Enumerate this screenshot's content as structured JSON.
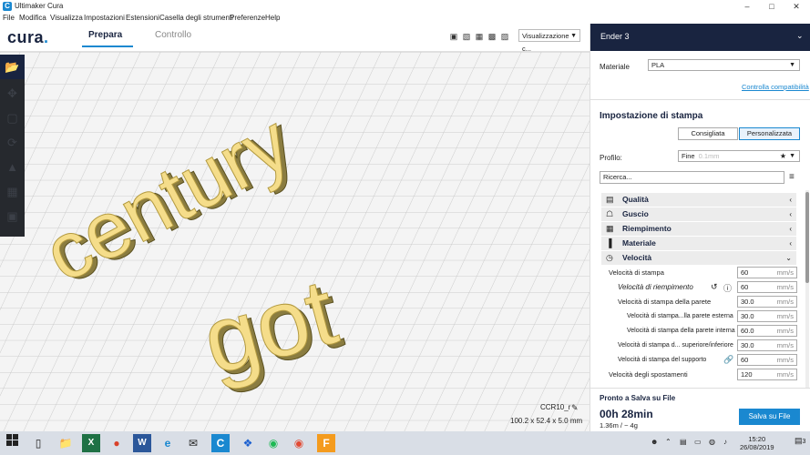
{
  "window": {
    "title": "Ultimaker Cura",
    "minimize": "–",
    "maximize": "□",
    "close": "✕"
  },
  "menu": [
    "File",
    "Modifica",
    "Visualizza",
    "Impostazioni",
    "Estensioni",
    "Casella degli strumenti",
    "Preferenze",
    "Help"
  ],
  "header": {
    "logo": "cura",
    "tabs": {
      "prepare": "Prepara",
      "monitor": "Controllo"
    },
    "view_select": "Visualizzazione c...",
    "view_icons": [
      "cube-3d-icon",
      "cube-front-icon",
      "cube-top-icon",
      "cube-left-icon",
      "cube-right-icon"
    ]
  },
  "scene": {
    "text_top": "century",
    "text_bottom": "got",
    "color": "#f5dd8a",
    "object_name": "CCR10_r",
    "object_dims": "100.2 x 52.4 x 5.0 mm"
  },
  "panel": {
    "printer": "Ender 3",
    "material_label": "Materiale",
    "material_value": "PLA",
    "compat_link": "Controlla compatibilità",
    "settings_title": "Impostazione di stampa",
    "mode_recommended": "Consigliata",
    "mode_custom": "Personalizzata",
    "profile_label": "Profilo:",
    "profile_value": "Fine",
    "profile_sub": "0.1mm",
    "search_placeholder": "Ricerca...",
    "categories": [
      {
        "label": "Qualità",
        "icon": "quality-icon",
        "glyph": "▤"
      },
      {
        "label": "Guscio",
        "icon": "shell-icon",
        "glyph": "☖"
      },
      {
        "label": "Riempimento",
        "icon": "infill-icon",
        "glyph": "▦"
      },
      {
        "label": "Materiale",
        "icon": "material-icon",
        "glyph": "▐"
      },
      {
        "label": "Velocità",
        "icon": "speed-icon",
        "glyph": "◷"
      }
    ],
    "speed_rows": [
      {
        "label": "Velocità di stampa",
        "value": "60",
        "unit": "mm/s"
      },
      {
        "label": "Velocità di riempimento",
        "value": "60",
        "unit": "mm/s"
      },
      {
        "label": "Velocità di stampa della parete",
        "value": "30.0",
        "unit": "mm/s"
      },
      {
        "label": "Velocità di stampa...lla parete esterna",
        "value": "30.0",
        "unit": "mm/s"
      },
      {
        "label": "Velocità di stampa della parete interna",
        "value": "60.0",
        "unit": "mm/s"
      },
      {
        "label": "Velocità di stampa d... superiore/inferiore",
        "value": "30.0",
        "unit": "mm/s"
      },
      {
        "label": "Velocità di stampa del supporto",
        "value": "60",
        "unit": "mm/s"
      },
      {
        "label": "Velocità degli spostamenti",
        "value": "120",
        "unit": "mm/s"
      }
    ],
    "ready_text": "Pronto a Salva su File",
    "print_time": "00h 28min",
    "material_usage": "1.36m / ~ 4g",
    "save_button": "Salva su File"
  },
  "taskbar": {
    "time": "15:20",
    "date": "26/08/2019",
    "notifications": "3"
  }
}
